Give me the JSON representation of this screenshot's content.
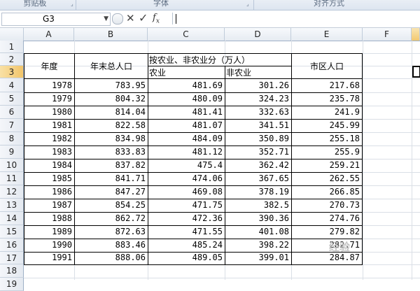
{
  "ribbon": {
    "groups": [
      "剪贴板",
      "字体",
      "对齐方式"
    ]
  },
  "formula_bar": {
    "name_box": "G3",
    "fx_label": "fx",
    "formula": ""
  },
  "columns": [
    "A",
    "B",
    "C",
    "D",
    "E",
    "F"
  ],
  "rows": [
    "1",
    "2",
    "3",
    "4",
    "5",
    "6",
    "7",
    "8",
    "9",
    "10",
    "11",
    "12",
    "13",
    "14",
    "15",
    "16",
    "17",
    "18",
    "19"
  ],
  "table": {
    "header_year": "年度",
    "header_total": "年末总人口",
    "header_group": "按农业、非农业分（万人）",
    "header_agri": "农业",
    "header_nonagri": "非农业",
    "header_urban": "市区人口",
    "data": [
      [
        "1978",
        "783.95",
        "481.69",
        "301.26",
        "217.68"
      ],
      [
        "1979",
        "804.32",
        "480.09",
        "324.23",
        "235.78"
      ],
      [
        "1980",
        "814.04",
        "481.41",
        "332.63",
        "241.9"
      ],
      [
        "1981",
        "822.58",
        "481.07",
        "341.51",
        "245.99"
      ],
      [
        "1982",
        "834.98",
        "484.09",
        "350.89",
        "255.18"
      ],
      [
        "1983",
        "833.83",
        "481.12",
        "352.71",
        "255.9"
      ],
      [
        "1984",
        "837.82",
        "475.4",
        "362.42",
        "259.21"
      ],
      [
        "1985",
        "841.71",
        "474.06",
        "367.65",
        "262.55"
      ],
      [
        "1986",
        "847.27",
        "469.08",
        "378.19",
        "266.85"
      ],
      [
        "1987",
        "854.25",
        "471.75",
        "382.5",
        "270.73"
      ],
      [
        "1988",
        "862.72",
        "472.36",
        "390.36",
        "274.76"
      ],
      [
        "1989",
        "872.63",
        "471.55",
        "401.08",
        "279.82"
      ],
      [
        "1990",
        "883.46",
        "485.24",
        "398.22",
        "282.71"
      ],
      [
        "1991",
        "888.06",
        "489.05",
        "399.01",
        "284.87"
      ]
    ]
  },
  "watermark": "经验"
}
